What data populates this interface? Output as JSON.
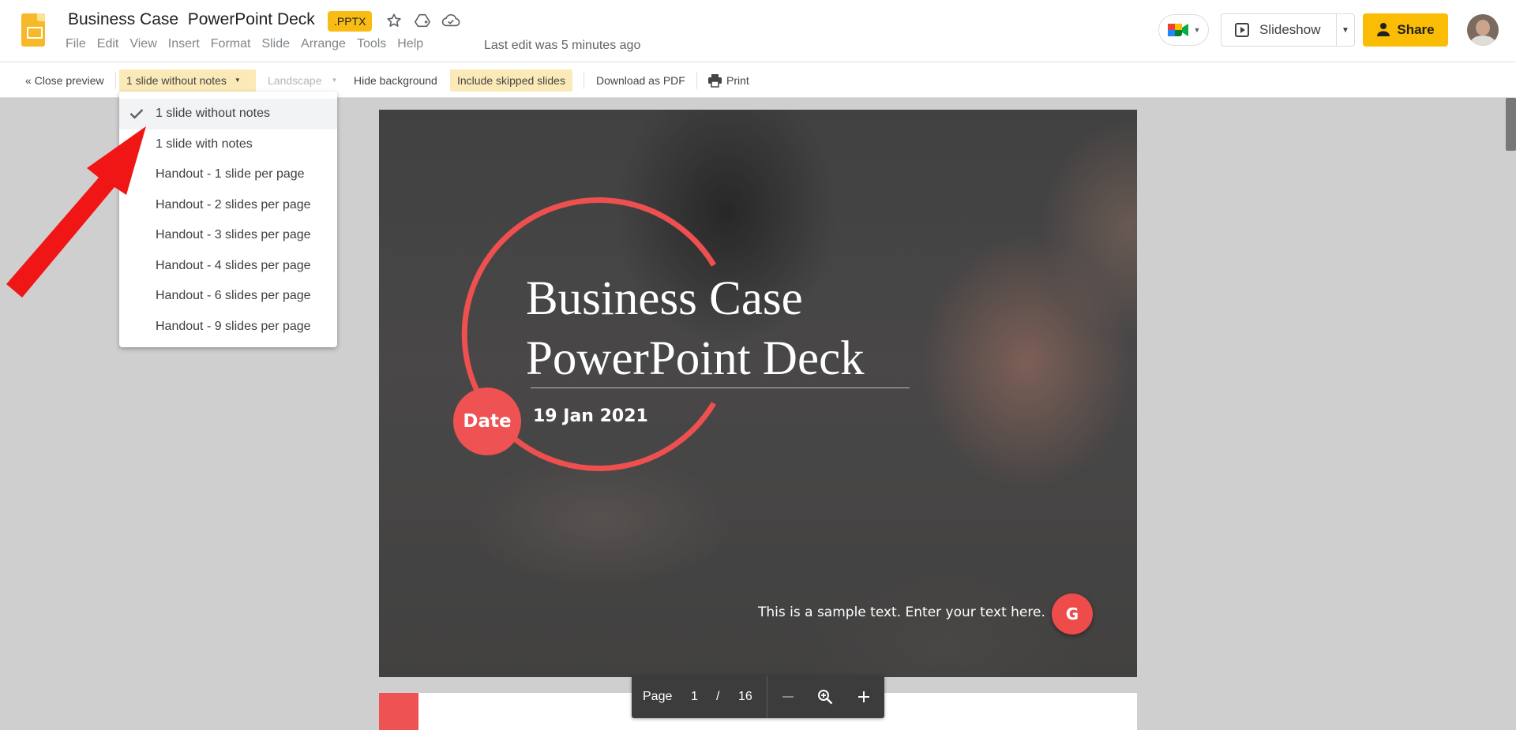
{
  "header": {
    "title": "Business Case  PowerPoint Deck",
    "badge": ".PPTX",
    "menu": [
      "File",
      "Edit",
      "View",
      "Insert",
      "Format",
      "Slide",
      "Arrange",
      "Tools",
      "Help"
    ],
    "last_edit": "Last edit was 5 minutes ago",
    "slideshow_label": "Slideshow",
    "share_label": "Share"
  },
  "toolbar": {
    "close_preview": "« Close preview",
    "layout_selected": "1 slide without notes",
    "orientation": "Landscape",
    "hide_background": "Hide background",
    "include_skipped": "Include skipped slides",
    "download_pdf": "Download as PDF",
    "print": "Print"
  },
  "dropdown": {
    "items": [
      "1 slide without notes",
      "1 slide with notes",
      "Handout - 1 slide per page",
      "Handout - 2 slides per page",
      "Handout - 3 slides per page",
      "Handout - 4 slides per page",
      "Handout - 6 slides per page",
      "Handout - 9 slides per page"
    ],
    "selected_index": 0
  },
  "slide": {
    "title_line1": "Business Case",
    "title_line2": "PowerPoint Deck",
    "date_badge": "Date",
    "date": "19 Jan 2021",
    "sample_text": "This is a sample text. Enter your text here.",
    "logo_letter": "G"
  },
  "page_controls": {
    "page_label": "Page",
    "current": "1",
    "separator": "/",
    "total": "16"
  },
  "colors": {
    "accent_yellow": "#fbbc04",
    "slide_red": "#ee5253",
    "annotation_arrow": "#f01616"
  }
}
